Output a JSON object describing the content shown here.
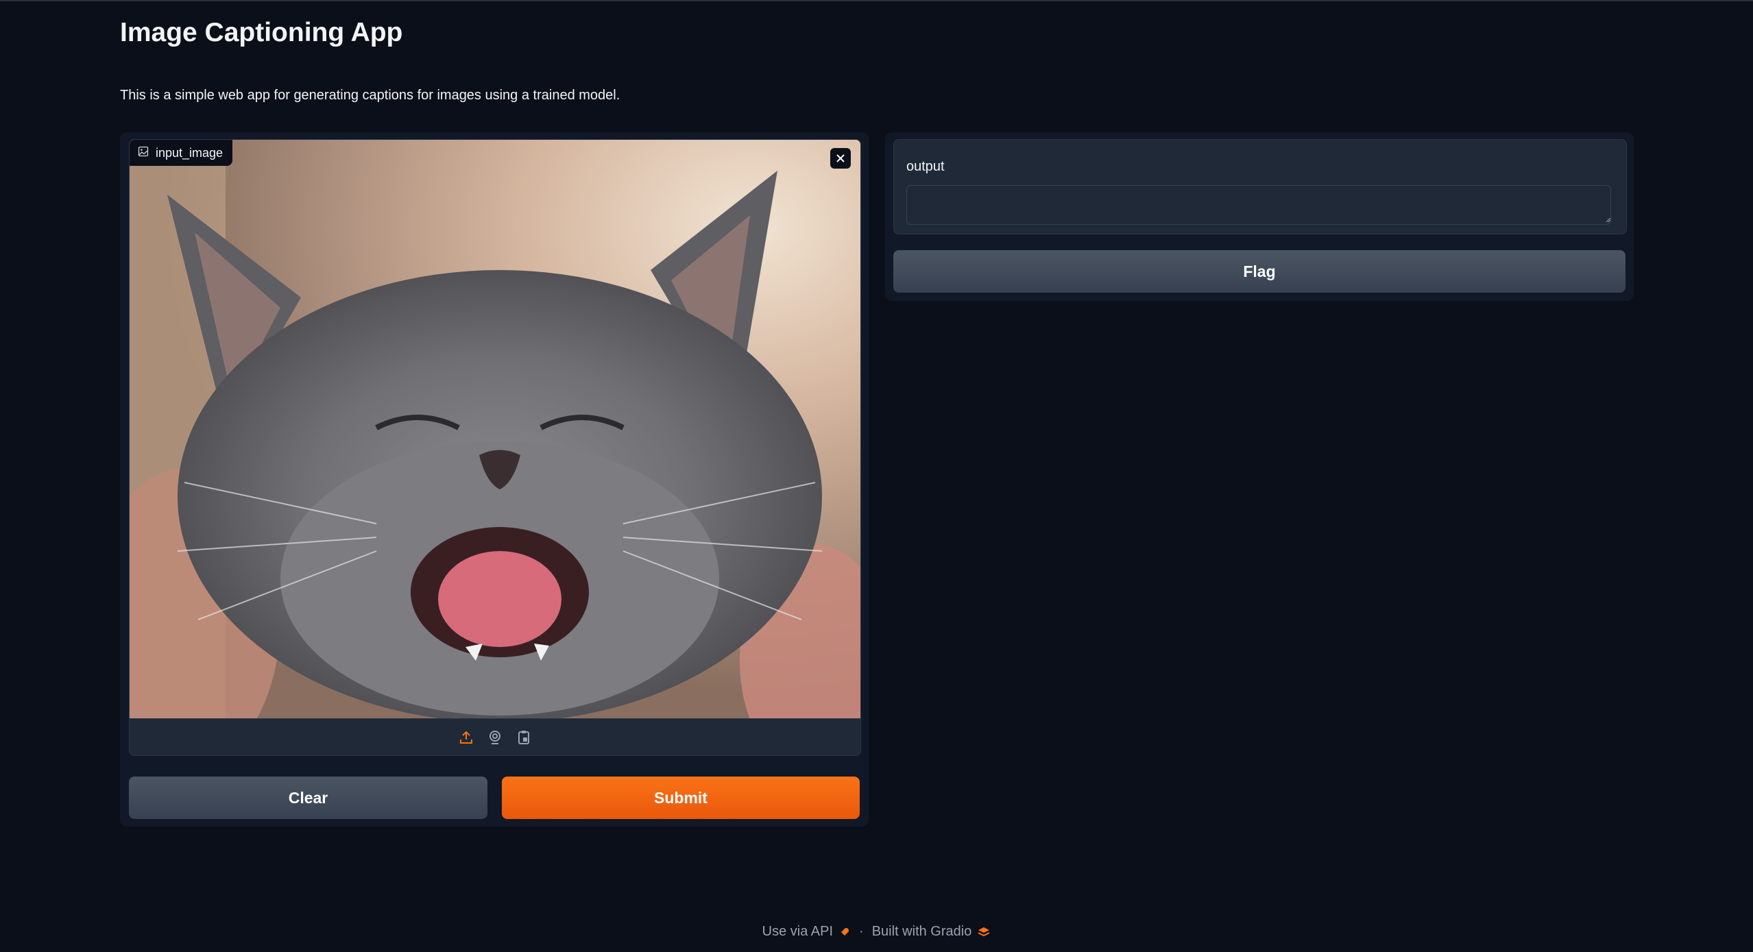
{
  "app": {
    "title": "Image Captioning App",
    "description": "This is a simple web app for generating captions for images using a trained model."
  },
  "input_image": {
    "label": "input_image",
    "label_icon": "image-icon",
    "close_icon": "close-icon",
    "toolbar_icons": [
      "upload-icon",
      "webcam-icon",
      "clipboard-icon"
    ],
    "image_subject": "cat-photo"
  },
  "actions": {
    "clear_label": "Clear",
    "submit_label": "Submit",
    "flag_label": "Flag"
  },
  "output": {
    "label": "output",
    "value": ""
  },
  "footer": {
    "api_link": "Use via API",
    "separator": "·",
    "built_with": "Built with Gradio"
  },
  "colors": {
    "background": "#0b0f19",
    "panel": "#111827",
    "block": "#1f2937",
    "accent": "#f97316",
    "secondary_button": "#4b5563"
  }
}
